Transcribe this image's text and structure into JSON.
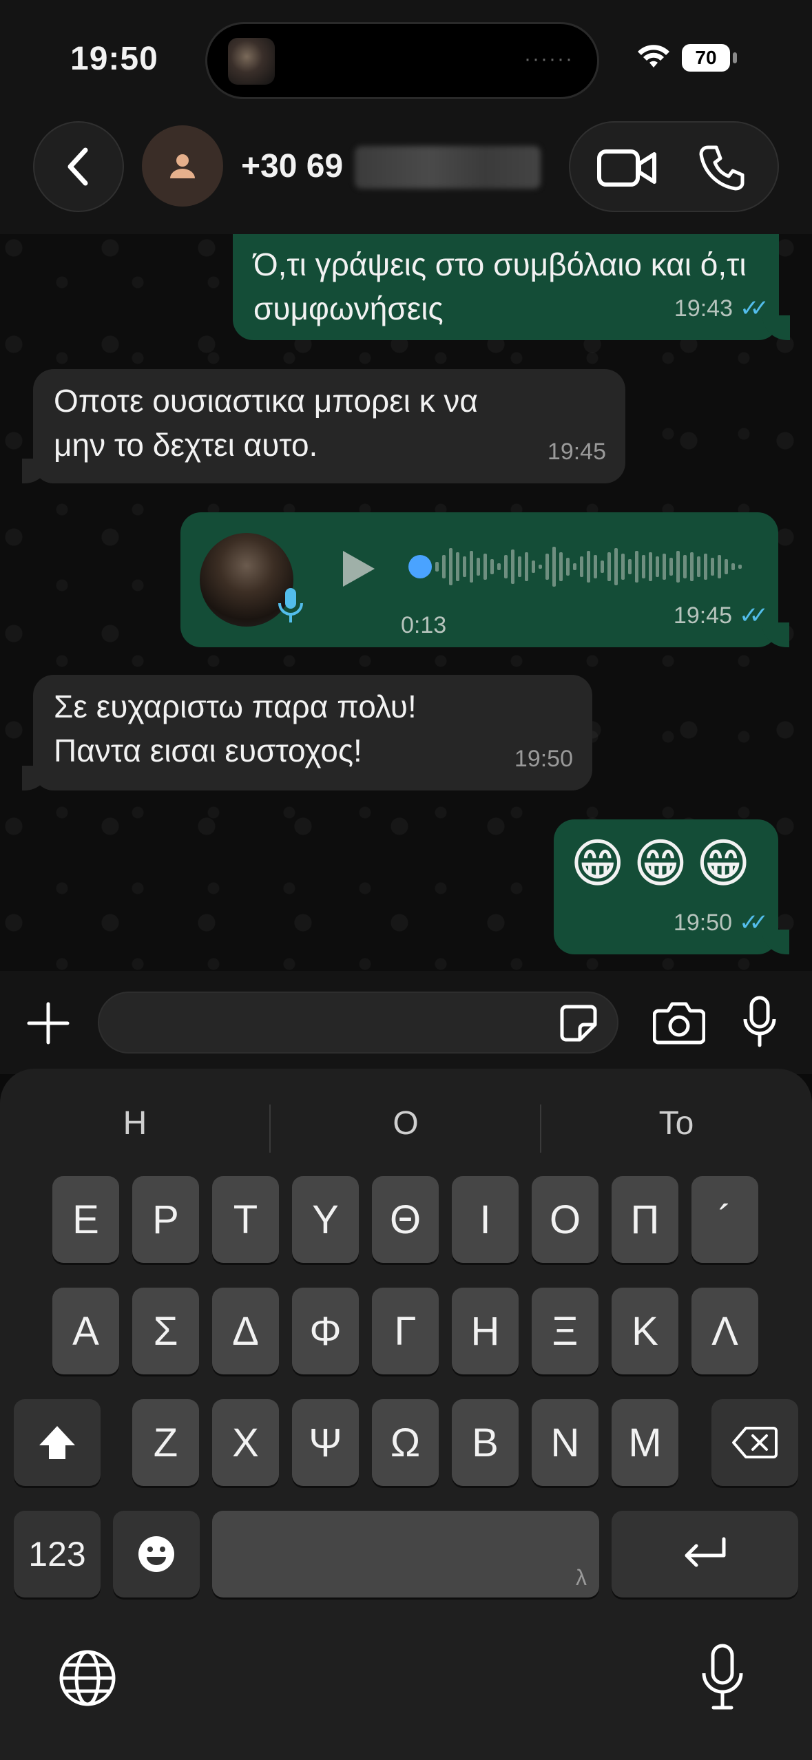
{
  "status_bar": {
    "time": "19:50",
    "battery": "70"
  },
  "header": {
    "contact_name": "+30 69"
  },
  "messages": [
    {
      "direction": "out",
      "text": "Ό,τι γράψεις στο συμβόλαιο και ό,τι συμφωνήσεις",
      "time": "19:43",
      "read": true
    },
    {
      "direction": "in",
      "text": "Οποτε ουσιαστικα μπορει κ να μην το δεχτει αυτο.",
      "time": "19:45"
    },
    {
      "direction": "out",
      "type": "voice",
      "duration": "0:13",
      "time": "19:45",
      "read": true
    },
    {
      "direction": "in",
      "text": "Σε ευχαριστω παρα πολυ! Παντα εισαι ευστοχος!",
      "time": "19:50"
    },
    {
      "direction": "out",
      "text": "😁😁😁",
      "time": "19:50",
      "read": true
    }
  ],
  "ticks": "✓✓",
  "keyboard": {
    "suggestions": [
      "Η",
      "Ο",
      "Το"
    ],
    "row1": [
      "Ε",
      "Ρ",
      "Τ",
      "Υ",
      "Θ",
      "Ι",
      "Ο",
      "Π",
      "´"
    ],
    "row2": [
      "Α",
      "Σ",
      "Δ",
      "Φ",
      "Γ",
      "Η",
      "Ξ",
      "Κ",
      "Λ"
    ],
    "row3": [
      "Ζ",
      "Χ",
      "Ψ",
      "Ω",
      "Β",
      "Ν",
      "Μ"
    ],
    "numbers_label": "123",
    "space_hint": "λ"
  },
  "colors": {
    "outgoing_bubble": "#144d37",
    "incoming_bubble": "#262626",
    "read_ticks": "#53bdeb",
    "voice_progress": "#4aa3ff"
  },
  "icons": [
    "wifi-icon",
    "back-icon",
    "person-icon",
    "video-icon",
    "phone-icon",
    "mic-icon",
    "play-icon",
    "plus-icon",
    "sticker-icon",
    "camera-icon",
    "shift-icon",
    "backspace-icon",
    "emoji-icon",
    "return-icon",
    "globe-icon"
  ]
}
